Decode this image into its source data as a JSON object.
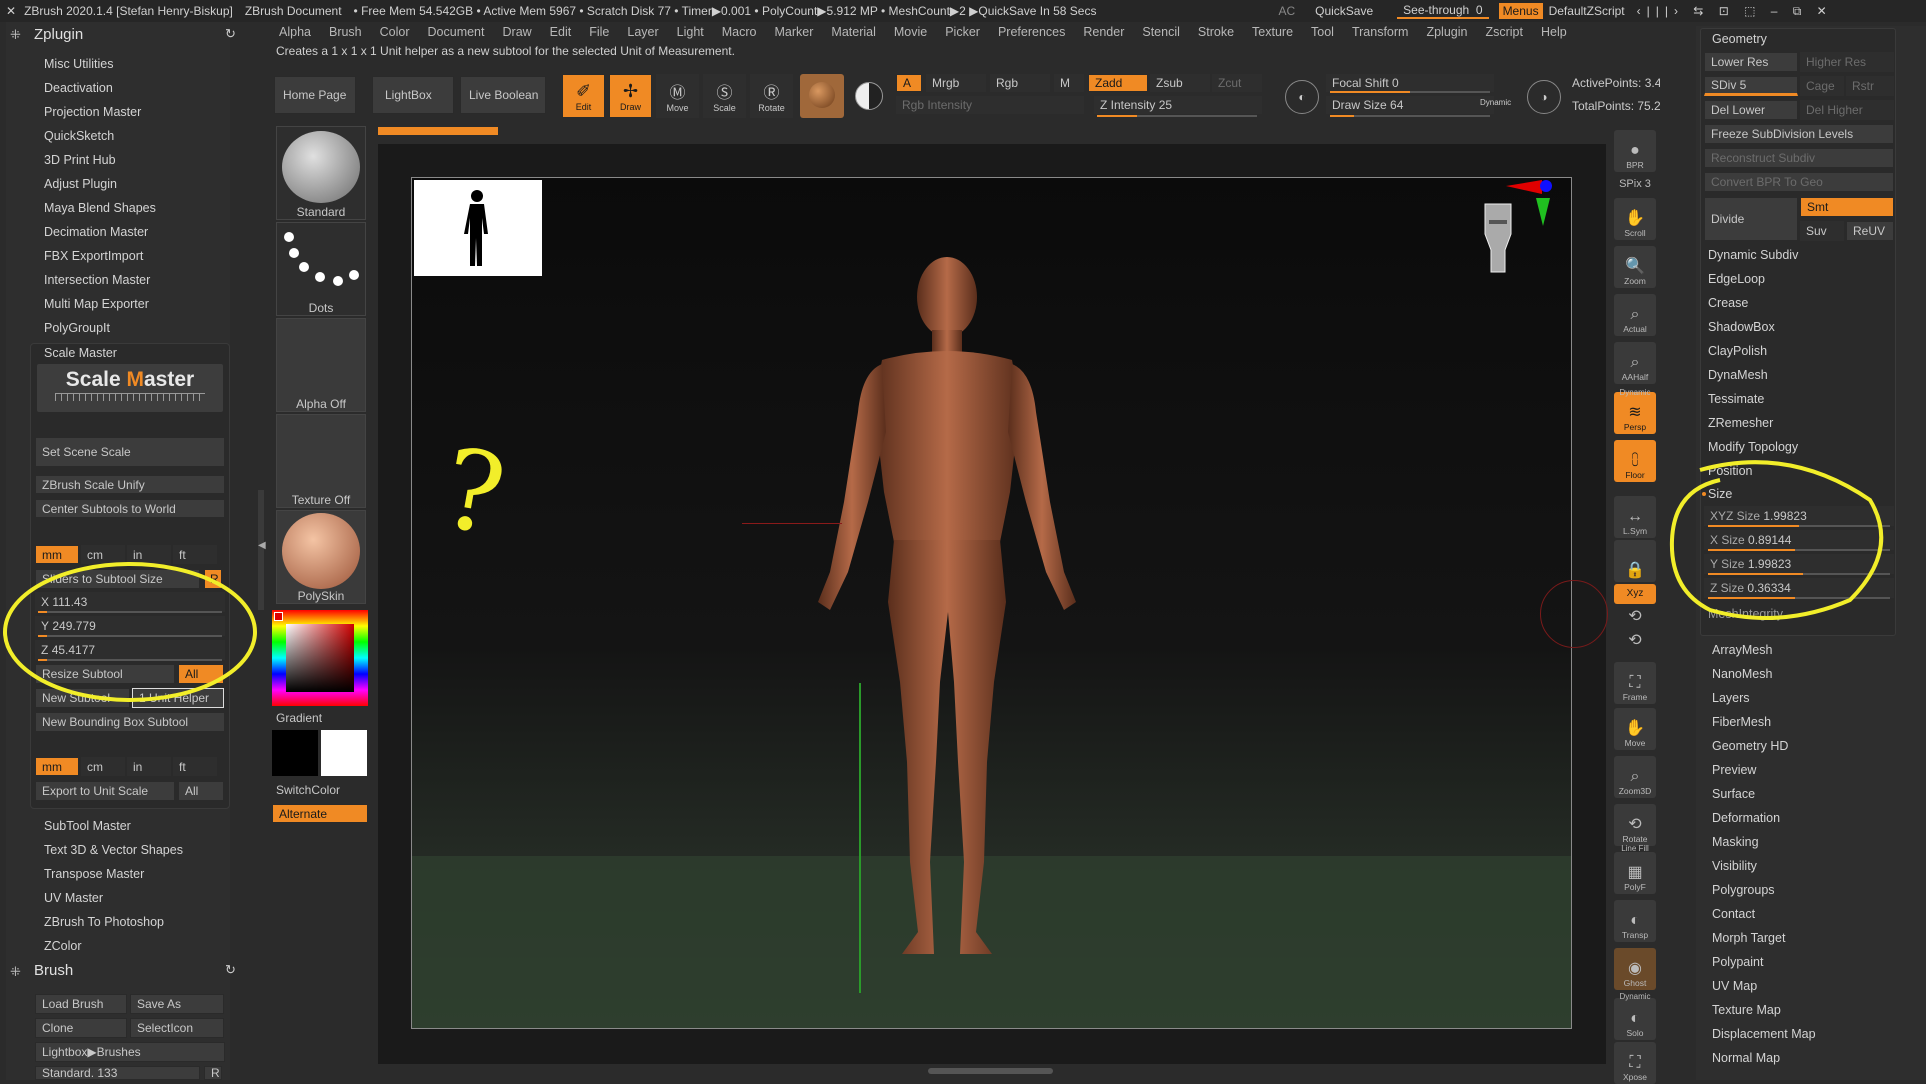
{
  "titlebar": {
    "app": "ZBrush 2020.1.4 [Stefan Henry-Biskup]",
    "doc": "ZBrush Document",
    "stats": "• Free Mem 54.542GB • Active Mem 5967 • Scratch Disk 77 •  Timer▶0.001 • PolyCount▶5.912 MP • MeshCount▶2  ▶QuickSave In 58 Secs",
    "ac": "AC",
    "quicksave": "QuickSave",
    "seethrough": "See-through",
    "seethrough_val": "0",
    "menus": "Menus",
    "zscript": "DefaultZScript"
  },
  "menubar": [
    "Alpha",
    "Brush",
    "Color",
    "Document",
    "Draw",
    "Edit",
    "File",
    "Layer",
    "Light",
    "Macro",
    "Marker",
    "Material",
    "Movie",
    "Picker",
    "Preferences",
    "Render",
    "Stencil",
    "Stroke",
    "Texture",
    "Tool",
    "Transform",
    "Zplugin",
    "Zscript",
    "Help"
  ],
  "hint": "Creates a 1 x 1 x 1 Unit helper as a new subtool for the selected Unit of Measurement.",
  "left": {
    "zplugin_title": "Zplugin",
    "plugins_top": [
      "Misc Utilities",
      "Deactivation",
      "Projection Master",
      "QuickSketch",
      "3D Print Hub",
      "Adjust Plugin",
      "Maya Blend Shapes",
      "Decimation Master",
      "FBX ExportImport",
      "Intersection Master",
      "Multi Map Exporter",
      "PolyGroupIt"
    ],
    "scale_master": {
      "title": "Scale Master",
      "logo_a": "Scale ",
      "logo_b": "M",
      "logo_c": "aster",
      "set_scene": "Set Scene Scale",
      "unify": "ZBrush Scale Unify",
      "center": "Center Subtools to World",
      "units": [
        "mm",
        "cm",
        "in",
        "ft"
      ],
      "sliders_to": "Sliders to Subtool Size",
      "r": "R",
      "x_label": "X",
      "x_val": "111.43",
      "x_fill": 0.05,
      "y_label": "Y",
      "y_val": "249.779",
      "y_fill": 0.05,
      "z_label": "Z",
      "z_val": "45.4177",
      "z_fill": 0.05,
      "resize": "Resize Subtool",
      "all": "All",
      "new_subtool": "New Subtool",
      "unit_helper": "1 Unit Helper",
      "new_bbox": "New Bounding Box Subtool",
      "units2": [
        "mm",
        "cm",
        "in",
        "ft"
      ],
      "export": "Export to Unit Scale",
      "all2": "All"
    },
    "plugins_bottom": [
      "SubTool Master",
      "Text 3D & Vector Shapes",
      "Transpose Master",
      "UV Master",
      "ZBrush To Photoshop",
      "ZColor"
    ],
    "brush_title": "Brush",
    "load_brush": "Load Brush",
    "save_as": "Save As",
    "clone": "Clone",
    "select_icon": "SelectIcon",
    "lightbox_brushes": "Lightbox▶Brushes",
    "standard_133": "Standard. 133",
    "r2": "R"
  },
  "shelf": {
    "home": "Home Page",
    "lightbox": "LightBox",
    "live_boolean": "Live Boolean",
    "edit": "Edit",
    "draw": "Draw",
    "move": "Move",
    "scale": "Scale",
    "rotate": "Rotate",
    "a": "A",
    "mrgb": "Mrgb",
    "rgb": "Rgb",
    "m": "M",
    "rgb_intensity": "Rgb Intensity",
    "zadd": "Zadd",
    "zsub": "Zsub",
    "zcut": "Zcut",
    "z_intensity": "Z Intensity 25",
    "z_intensity_fill": 0.25,
    "focal_shift": "Focal Shift 0",
    "focal_fill": 0.5,
    "draw_size": "Draw Size 64",
    "draw_size_fill": 0.15,
    "dynamic": "Dynamic",
    "active_points": "ActivePoints: 3.4",
    "total_points": "TotalPoints: 75.2"
  },
  "brushcol": {
    "standard": "Standard",
    "dots": "Dots",
    "alpha_off": "Alpha Off",
    "texture_off": "Texture Off",
    "polyskin": "PolySkin",
    "gradient": "Gradient",
    "switchcolor": "SwitchColor",
    "alternate": "Alternate"
  },
  "viewport": {
    "question": "?",
    "axis_colors": {
      "x": "#e00000",
      "y": "#20c020",
      "z": "#1010ff"
    }
  },
  "rightbar": [
    "BPR",
    "SPix 3",
    "Scroll",
    "Zoom",
    "Actual",
    "AAHalf",
    "Persp",
    "Floor",
    "L.Sym",
    "",
    "Xyz",
    "",
    "",
    "Frame",
    "Move",
    "Zoom3D",
    "Rotate",
    "PolyF",
    "Transp",
    "Ghost",
    "Solo",
    "Xpose"
  ],
  "rightbar_labels": {
    "bpr": "BPR",
    "spix": "SPix 3",
    "scroll": "Scroll",
    "zoom": "Zoom",
    "actual": "Actual",
    "aahalf": "AAHalf",
    "dynamic": "Dynamic",
    "persp": "Persp",
    "floor": "Floor",
    "lsym": "L.Sym",
    "xyz": "Xyz",
    "frame": "Frame",
    "move": "Move",
    "zoom3d": "Zoom3D",
    "rotate": "Rotate",
    "linefill": "Line Fill",
    "polyf": "PolyF",
    "transp": "Transp",
    "ghost": "Ghost",
    "dynamic2": "Dynamic",
    "solo": "Solo",
    "xpose": "Xpose"
  },
  "geometry": {
    "title": "Geometry",
    "lower_res": "Lower Res",
    "higher_res": "Higher Res",
    "sdiv": "SDiv 5",
    "cage": "Cage",
    "rstr": "Rstr",
    "del_lower": "Del Lower",
    "del_higher": "Del Higher",
    "freeze": "Freeze SubDivision Levels",
    "reconstruct": "Reconstruct Subdiv",
    "convert_bpr": "Convert BPR To Geo",
    "divide": "Divide",
    "smt": "Smt",
    "suv": "Suv",
    "reuv": "ReUV",
    "items": [
      "Dynamic Subdiv",
      "EdgeLoop",
      "Crease",
      "ShadowBox",
      "ClayPolish",
      "DynaMesh",
      "Tessimate",
      "ZRemesher",
      "Modify Topology",
      "Position"
    ],
    "size_title": "Size",
    "xyz_size": "XYZ Size",
    "xyz_val": "1.99823",
    "x_size": "X Size",
    "x_val": "0.89144",
    "y_size": "Y Size",
    "y_val": "1.99823",
    "z_size": "Z Size",
    "z_val": "0.36334",
    "mesh_integrity": "MeshIntegrity",
    "items2": [
      "ArrayMesh",
      "NanoMesh",
      "Layers",
      "FiberMesh",
      "Geometry HD",
      "Preview",
      "Surface",
      "Deformation",
      "Masking",
      "Visibility",
      "Polygroups",
      "Contact",
      "Morph Target",
      "Polypaint",
      "UV Map",
      "Texture Map",
      "Displacement Map",
      "Normal Map"
    ]
  }
}
